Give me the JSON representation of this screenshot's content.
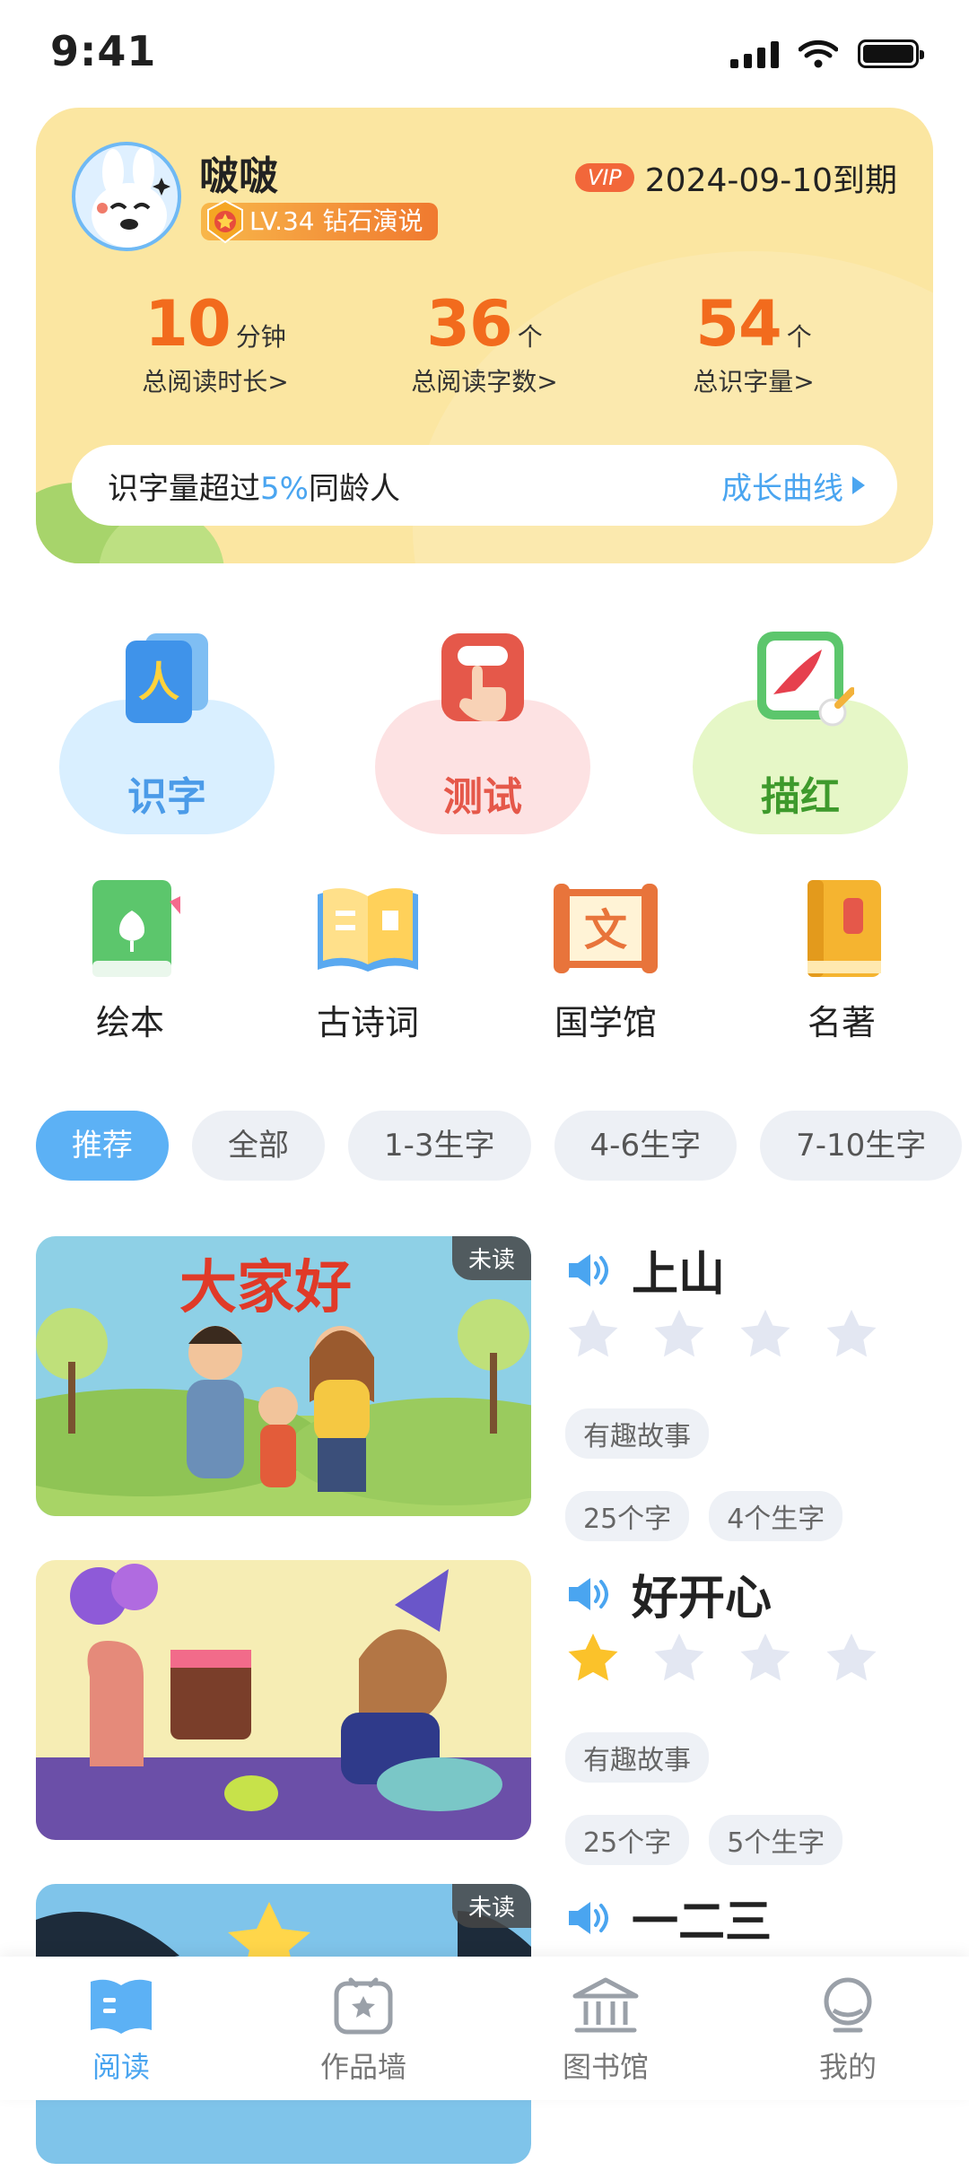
{
  "status_bar": {
    "time": "9:41"
  },
  "profile": {
    "name": "啵啵",
    "level": "LV.34 钻石演说",
    "vip_tag": "VIP",
    "vip_expiry": "2024-09-10到期",
    "stats": [
      {
        "value": "10",
        "unit": "分钟",
        "label": "总阅读时长>"
      },
      {
        "value": "36",
        "unit": "个",
        "label": "总阅读字数>"
      },
      {
        "value": "54",
        "unit": "个",
        "label": "总识字量>"
      }
    ],
    "growth": {
      "prefix": "识字量超过",
      "percent": "5%",
      "suffix": "同龄人",
      "link": "成长曲线"
    }
  },
  "main_features": [
    {
      "label": "识字",
      "icon": "character-card-icon",
      "color": "#4b9be8"
    },
    {
      "label": "测试",
      "icon": "test-tap-icon",
      "color": "#e5584a"
    },
    {
      "label": "描红",
      "icon": "tracing-icon",
      "color": "#3e9a2c"
    }
  ],
  "sub_features": [
    {
      "label": "绘本",
      "icon": "picture-book-icon"
    },
    {
      "label": "古诗词",
      "icon": "open-book-icon"
    },
    {
      "label": "国学馆",
      "icon": "scroll-icon"
    },
    {
      "label": "名著",
      "icon": "classic-book-icon"
    }
  ],
  "filters": [
    "推荐",
    "全部",
    "1-3生字",
    "4-6生字",
    "7-10生字"
  ],
  "books": [
    {
      "title": "上山",
      "badge": "未读",
      "stars": 0,
      "tags": [
        "有趣故事",
        "25个字",
        "4个生字"
      ],
      "cover_text": "大家好"
    },
    {
      "title": "好开心",
      "badge": "",
      "stars": 1,
      "tags": [
        "有趣故事",
        "25个字",
        "5个生字"
      ],
      "cover_text": ""
    },
    {
      "title": "一二三",
      "badge": "未读",
      "stars": 0,
      "tags": [],
      "cover_text": ""
    }
  ],
  "bottom_nav": [
    {
      "label": "阅读",
      "icon": "book-tab-icon",
      "active": true
    },
    {
      "label": "作品墙",
      "icon": "frame-star-icon",
      "active": false
    },
    {
      "label": "图书馆",
      "icon": "library-icon",
      "active": false
    },
    {
      "label": "我的",
      "icon": "profile-icon",
      "active": false
    }
  ]
}
